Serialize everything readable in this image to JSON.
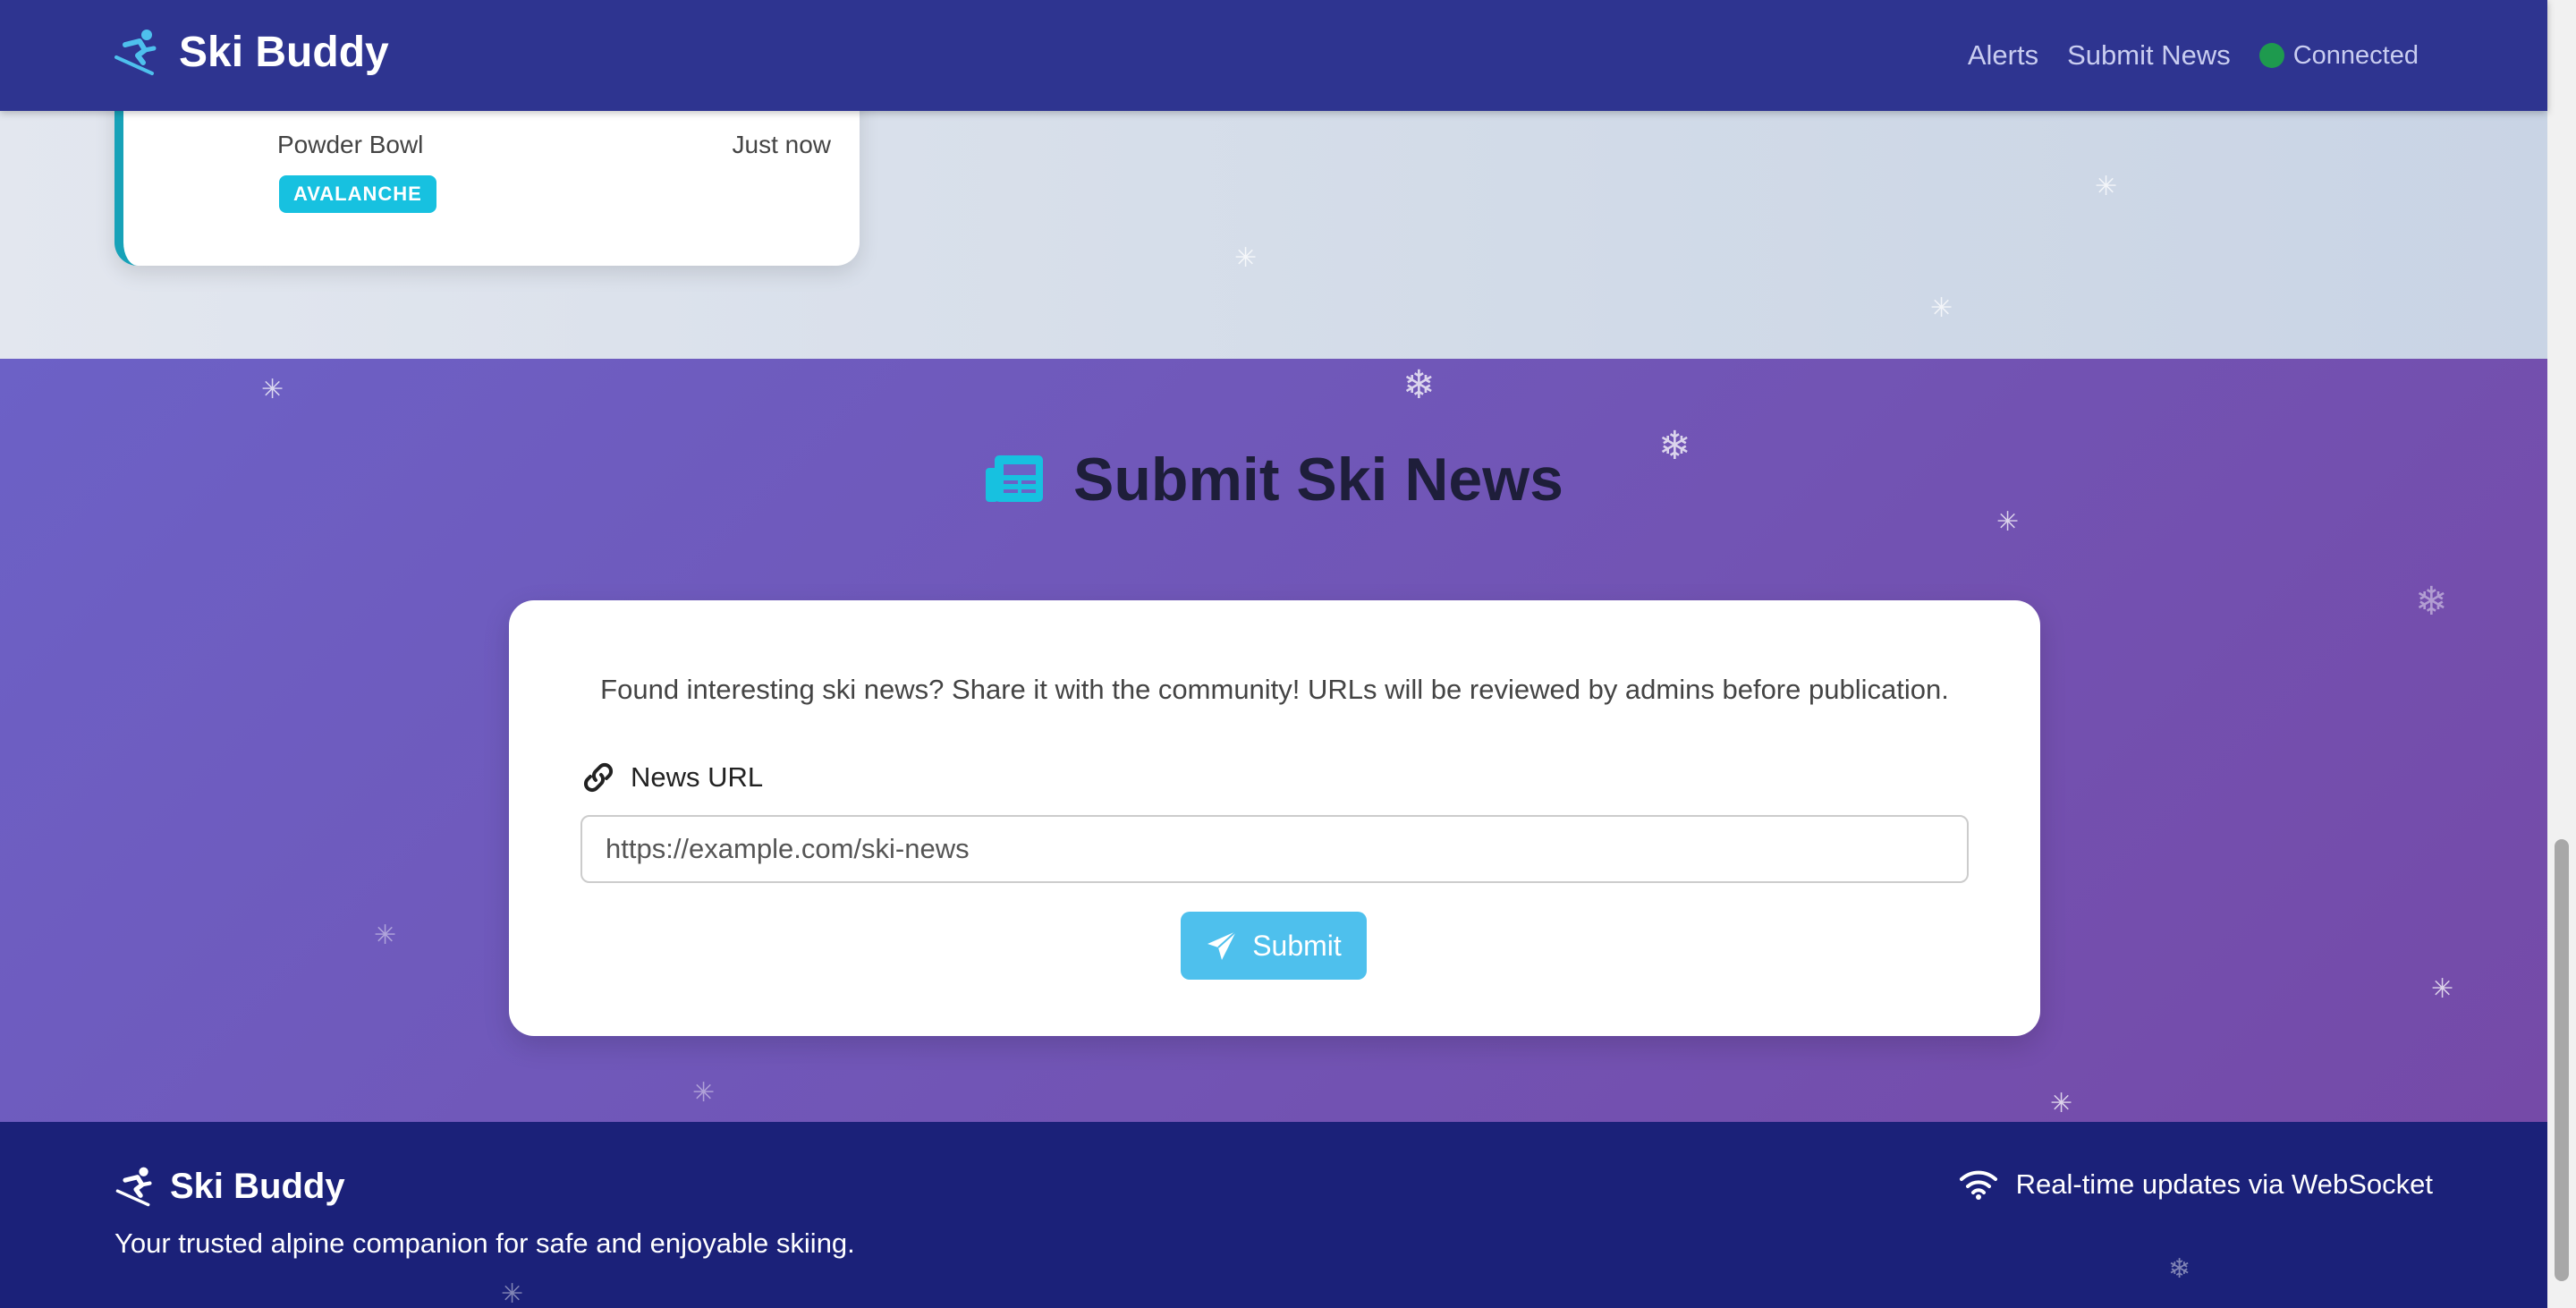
{
  "navbar": {
    "brand": "Ski Buddy",
    "links": [
      "Alerts",
      "Submit News"
    ],
    "status": "Connected",
    "status_color": "#1e9a4e"
  },
  "alert_card": {
    "location": "Powder Bowl",
    "time": "Just now",
    "badge": "AVALANCHE",
    "accent": "#17a2b8"
  },
  "submit": {
    "title": "Submit Ski News",
    "description": "Found interesting ski news? Share it with the community! URLs will be reviewed by admins before publication.",
    "url_label": "News URL",
    "url_placeholder": "https://example.com/ski-news",
    "button_label": "Submit",
    "button_color": "#4ec0ed"
  },
  "footer": {
    "brand": "Ski Buddy",
    "tagline": "Your trusted alpine companion for safe and enjoyable skiing.",
    "realtime": "Real-time updates via WebSocket"
  },
  "icons": {
    "brand": "skier-icon",
    "title": "newspaper-icon",
    "label": "link-icon",
    "button": "paper-plane-icon",
    "realtime": "wifi-icon",
    "decor": "snowflake-icon"
  }
}
